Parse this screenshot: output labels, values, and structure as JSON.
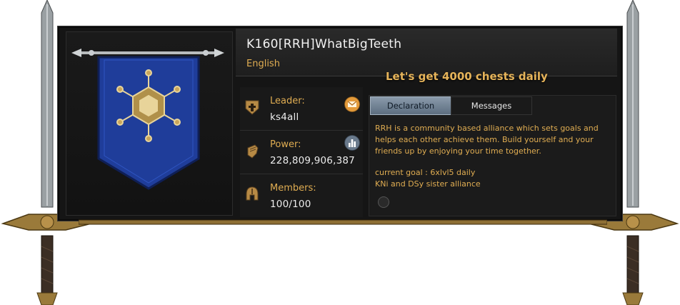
{
  "alliance": {
    "name": "K160[RRH]WhatBigTeeth",
    "language": "English",
    "motto": "Let's get 4000 chests daily"
  },
  "stats": {
    "leader": {
      "label": "Leader:",
      "value": "ks4all",
      "icon": "leader-crest-icon"
    },
    "power": {
      "label": "Power:",
      "value": "228,809,906,387",
      "icon": "fist-icon"
    },
    "members": {
      "label": "Members:",
      "value": "100/100",
      "icon": "helmet-icon"
    }
  },
  "tabs": {
    "declaration": "Declaration",
    "messages": "Messages"
  },
  "declaration": {
    "paragraph1": "RRH is a community based alliance which sets goals and helps each other achieve them. Build yourself and your friends up by enjoying your time together.",
    "line2": "current goal : 6xlvl5 daily",
    "line3": "KNi and DSy sister alliance"
  },
  "colors": {
    "gold": "#e0ad52",
    "banner_blue": "#1f3d9a",
    "active_tab": "#7a8a9c",
    "mail_orange": "#e39a3a"
  }
}
